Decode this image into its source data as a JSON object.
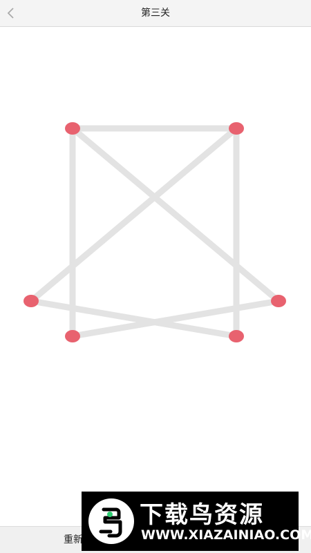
{
  "header": {
    "title": "第三关",
    "back_icon": "chevron-left-icon"
  },
  "footer": {
    "restart_label": "重新开始"
  },
  "watermark": {
    "brand": "下载鸟资源",
    "url": "WWW.XIAZAINIAO.COM"
  },
  "colors": {
    "node": "#e8626f",
    "line": "#e3e3e3",
    "header_bg": "#f4f4f4"
  },
  "puzzle": {
    "node_count": 6,
    "edge_count": 7,
    "nodes": [
      "top-left",
      "top-right",
      "left",
      "right",
      "bottom-left",
      "bottom-right"
    ],
    "edges": [
      [
        "top-left",
        "top-right"
      ],
      [
        "top-left",
        "bottom-left"
      ],
      [
        "top-right",
        "bottom-right"
      ],
      [
        "top-left",
        "right"
      ],
      [
        "top-right",
        "left"
      ],
      [
        "left",
        "bottom-right"
      ],
      [
        "right",
        "bottom-left"
      ]
    ]
  }
}
